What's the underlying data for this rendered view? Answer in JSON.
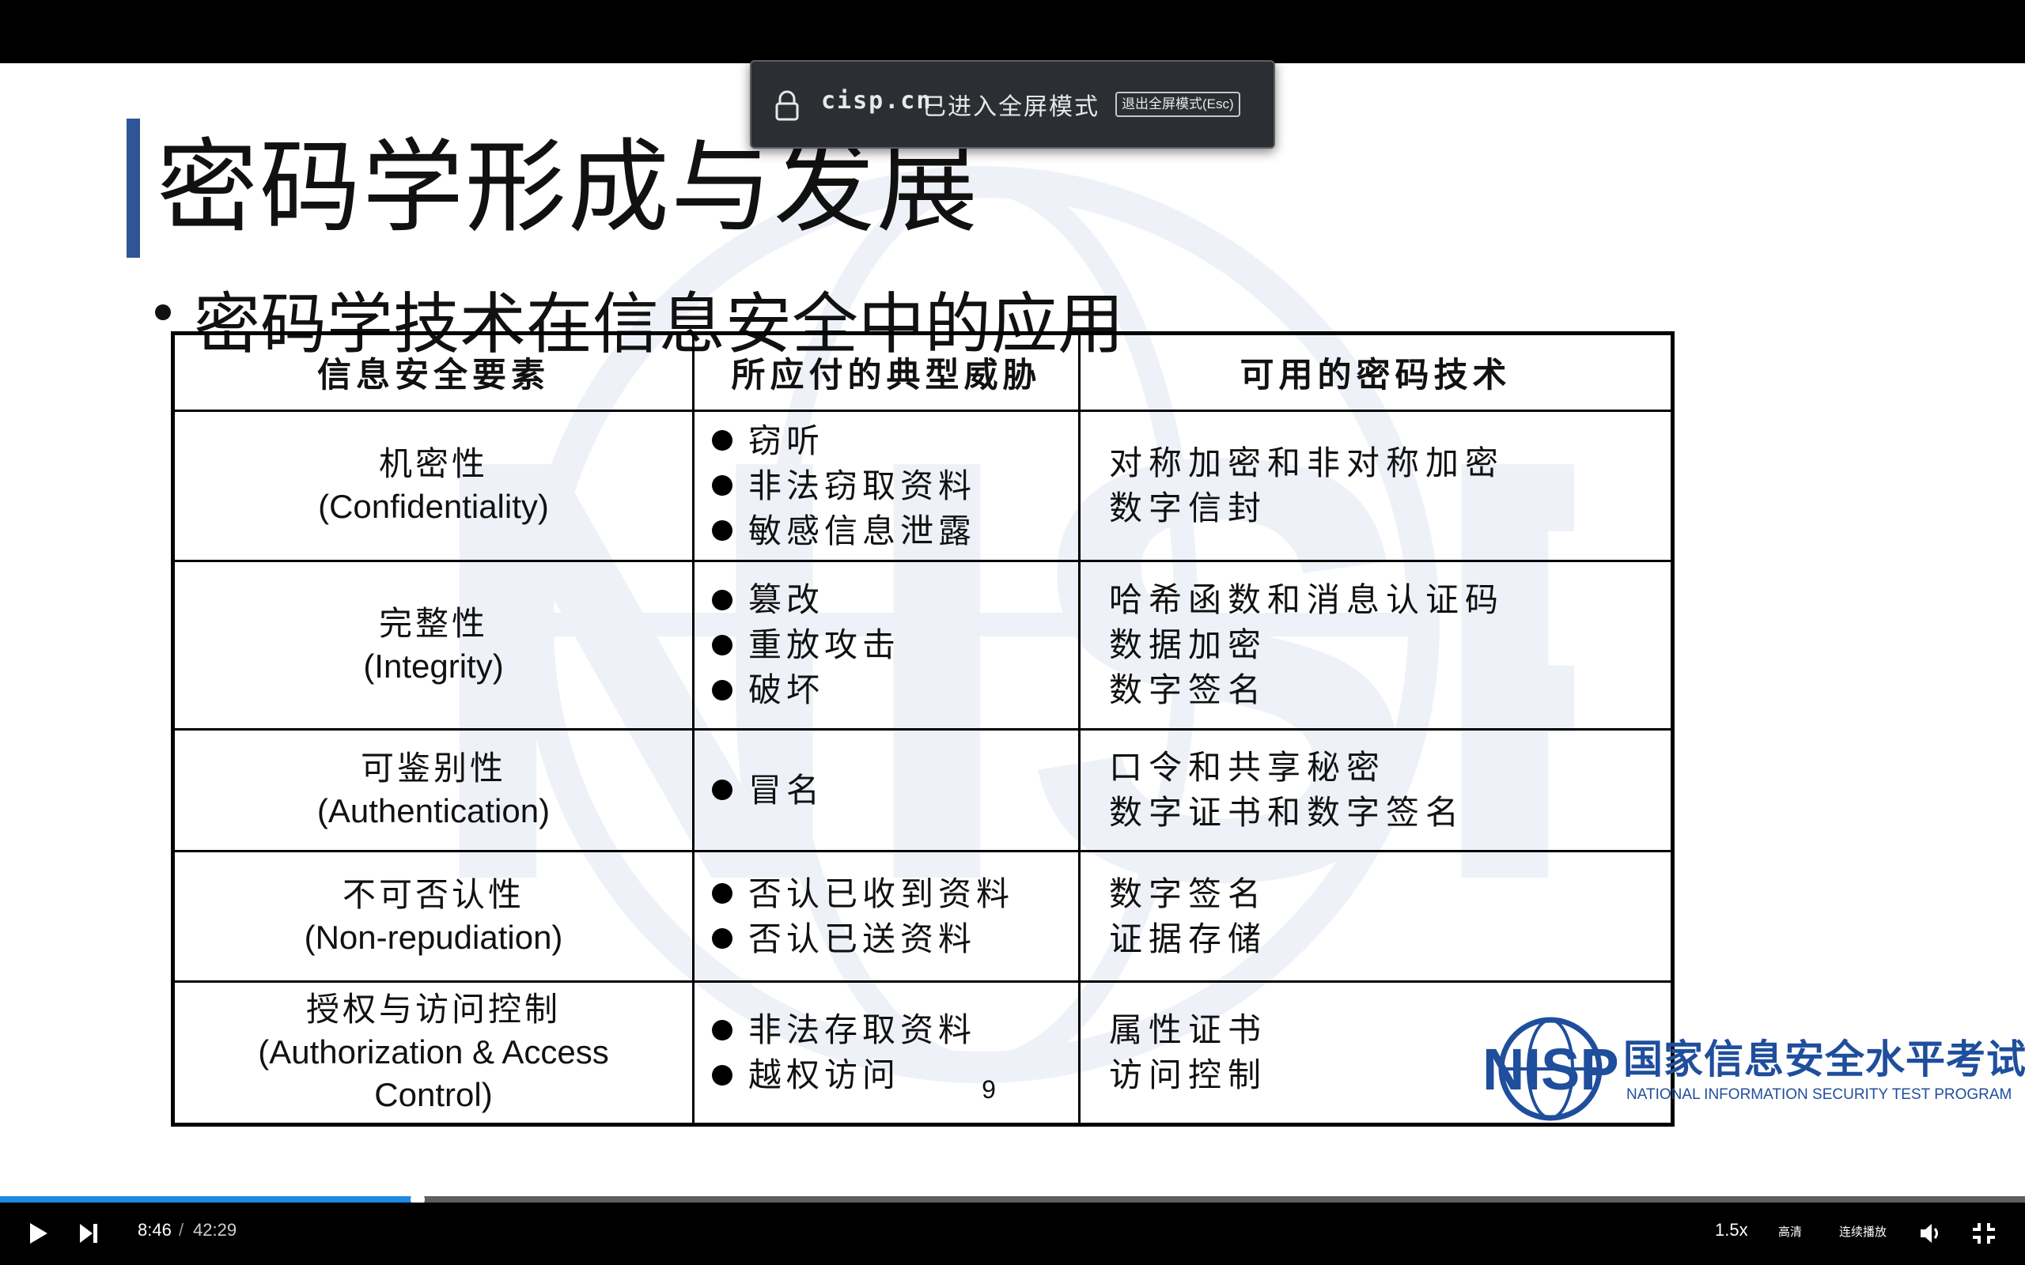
{
  "slide": {
    "title": "密码学形成与发展",
    "subtitle": "密码学技术在信息安全中的应用",
    "page_number": "9",
    "table": {
      "headers": [
        "信息安全要素",
        "所应付的典型威胁",
        "可用的密码技术"
      ],
      "rows": [
        {
          "element_cn": "机密性",
          "element_en": "(Confidentiality)",
          "threats": [
            "窃听",
            "非法窃取资料",
            "敏感信息泄露"
          ],
          "techniques": [
            "对称加密和非对称加密",
            "数字信封"
          ]
        },
        {
          "element_cn": "完整性",
          "element_en": "(Integrity)",
          "threats": [
            "篡改",
            "重放攻击",
            "破坏"
          ],
          "techniques": [
            "哈希函数和消息认证码",
            "数据加密",
            "数字签名"
          ]
        },
        {
          "element_cn": "可鉴别性",
          "element_en": "(Authentication)",
          "threats": [
            "冒名"
          ],
          "techniques": [
            "口令和共享秘密",
            "数字证书和数字签名"
          ]
        },
        {
          "element_cn": "不可否认性",
          "element_en": "(Non-repudiation)",
          "threats": [
            "否认已收到资料",
            "否认已送资料"
          ],
          "techniques": [
            "数字签名",
            "证据存储"
          ]
        },
        {
          "element_cn": "授权与访问控制",
          "element_en": "(Authorization & Access",
          "element_en2": "Control)",
          "threats": [
            "非法存取资料",
            "越权访问"
          ],
          "techniques": [
            "属性证书",
            "访问控制"
          ]
        }
      ]
    },
    "logo": {
      "mark": "NISP",
      "cn": "国家信息安全水平考试",
      "en": "NATIONAL INFORMATION SECURITY TEST PROGRAM"
    }
  },
  "fullscreen_notice": {
    "domain": "cisp.cn",
    "message": "已进入全屏模式",
    "exit_label": "退出全屏模式(Esc)",
    "icon": "lock-icon"
  },
  "player": {
    "current_time": "8:46",
    "separator": "/",
    "duration": "42:29",
    "progress_fraction": 0.2064,
    "speed": "1.5x",
    "quality": "高清",
    "autoplay": "连续播放",
    "icons": [
      "play-icon",
      "next-icon",
      "volume-icon",
      "exit-fullscreen-icon"
    ],
    "accent_color": "#1e88e5"
  }
}
